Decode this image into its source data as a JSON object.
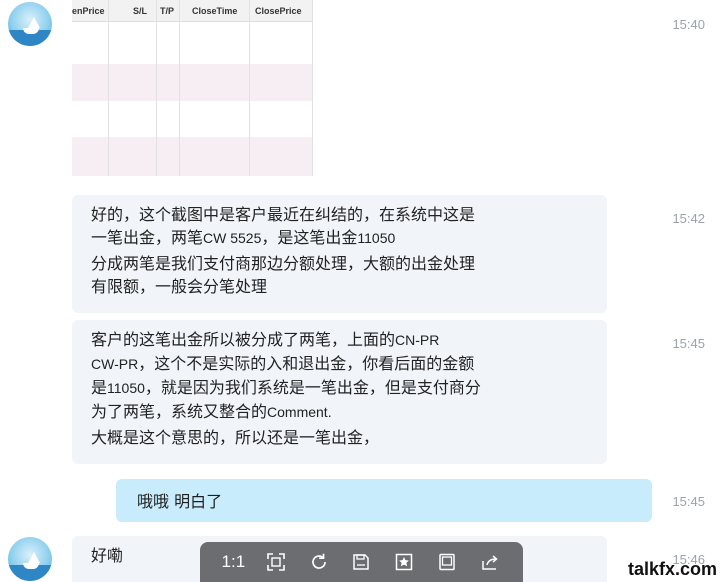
{
  "messages": [
    {
      "time": "15:40",
      "table_headers": [
        "enPrice",
        "S/L",
        "T/P",
        "CloseTime",
        "ClosePrice"
      ]
    },
    {
      "time": "15:42",
      "line1": "好的，这个截图中是客户最近在纠结的，在系统中这是",
      "line2a": "一笔出金，两笔",
      "line2b": "CW 5525",
      "line2c": "，是这笔出金",
      "line2d": "11050",
      "line3": "分成两笔是我们支付商那边分额处理，大额的出金处理",
      "line4": "有限额，一般会分笔处理"
    },
    {
      "time": "15:45",
      "line1a": "客户的这笔出金所以被分成了两笔，上面的",
      "line1b": "CN-PR",
      "line2a": "CW-PR",
      "line2b": "，这个不是实际的入和退出金，你看后面的金额",
      "line3a": "是",
      "line3b": "11050",
      "line3c": "，就是因为我们系统是一笔出金，但是支付商分",
      "line4a": "为了两笔，系统又整合的",
      "line4b": "Comment.",
      "line5": "大概是这个意思的，所以还是一笔出金，"
    },
    {
      "time": "15:45",
      "text": "哦哦 明白了"
    },
    {
      "time": "15:46",
      "text": "好嘞"
    }
  ],
  "viewer": {
    "actual_size_label": "1:1"
  },
  "icons": [
    "avatar",
    "fit-screen-icon",
    "rotate-icon",
    "save-icon",
    "star-icon",
    "present-icon",
    "share-icon"
  ],
  "watermark": "talkfx.com"
}
